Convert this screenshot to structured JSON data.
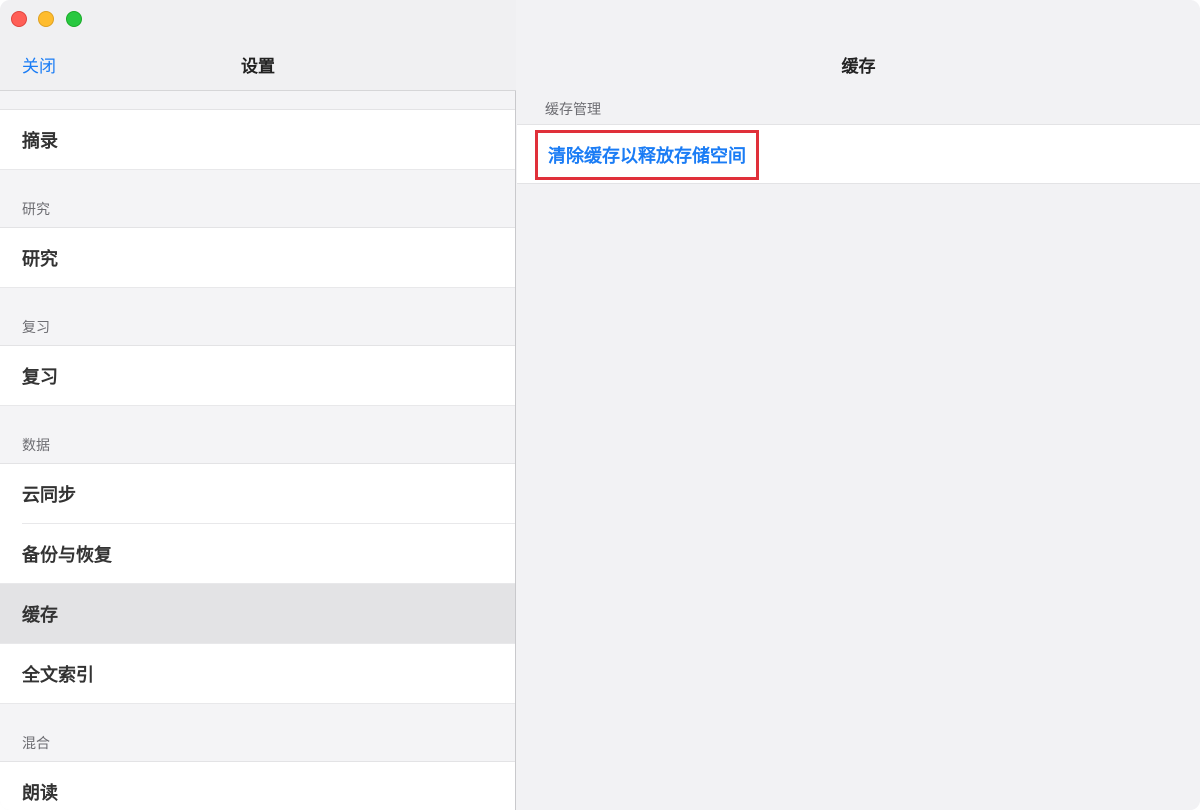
{
  "window": {
    "traffic_lights": [
      "close",
      "minimize",
      "zoom"
    ]
  },
  "sidebar": {
    "close_label": "关闭",
    "title": "设置",
    "first_row": "摘录",
    "sections": [
      {
        "header": "研究",
        "items": [
          "研究"
        ]
      },
      {
        "header": "复习",
        "items": [
          "复习"
        ]
      },
      {
        "header": "数据",
        "items": [
          "云同步",
          "备份与恢复",
          "缓存",
          "全文索引"
        ]
      },
      {
        "header": "混合",
        "items": [
          "朗读"
        ]
      }
    ],
    "selected_item": "缓存"
  },
  "main": {
    "title": "缓存",
    "section_label": "缓存管理",
    "action_label": "清除缓存以释放存储空间"
  },
  "colors": {
    "accent": "#1a7cf5",
    "highlight_box": "#e0303a",
    "selected_row": "#e3e3e5"
  }
}
